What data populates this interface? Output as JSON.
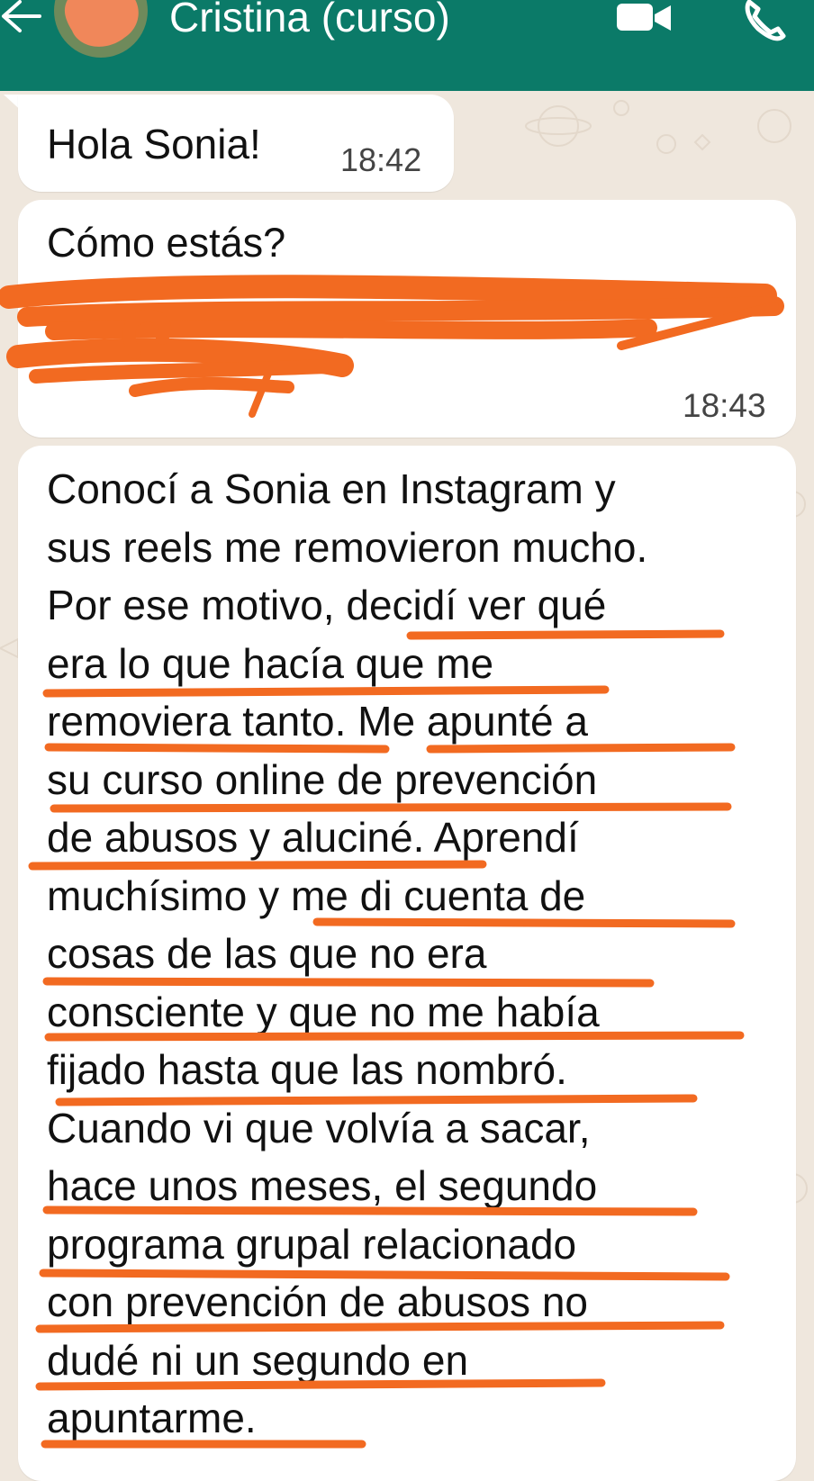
{
  "header": {
    "contact_name": "Cristina (curso)",
    "background_color": "#0b7a68",
    "icons": [
      "back-arrow-icon",
      "video-call-icon",
      "phone-call-icon"
    ]
  },
  "messages": [
    {
      "text": "Hola Sonia!",
      "time": "18:42"
    },
    {
      "text": "Cómo estás?",
      "time": "18:43"
    },
    {
      "lines": [
        "Conocí a Sonia en Instagram y",
        "sus reels me removieron mucho.",
        "Por ese motivo, decidí ver qué",
        "era lo que hacía que me",
        "removiera tanto. Me apunté a",
        "su curso online de prevención",
        "de abusos y aluciné. Aprendí",
        "muchísimo y me di cuenta de",
        "cosas de las que no era",
        "consciente y que no me había",
        "fijado hasta que las nombró.",
        "Cuando vi que volvía a sacar,",
        "hace unos meses, el segundo",
        "programa grupal relacionado",
        "con prevención de abusos no",
        "dudé ni un segundo en",
        "apuntarme."
      ]
    }
  ],
  "colors": {
    "annotation": "#f26a21",
    "chat_background": "#efe7dd",
    "bubble": "#ffffff"
  }
}
